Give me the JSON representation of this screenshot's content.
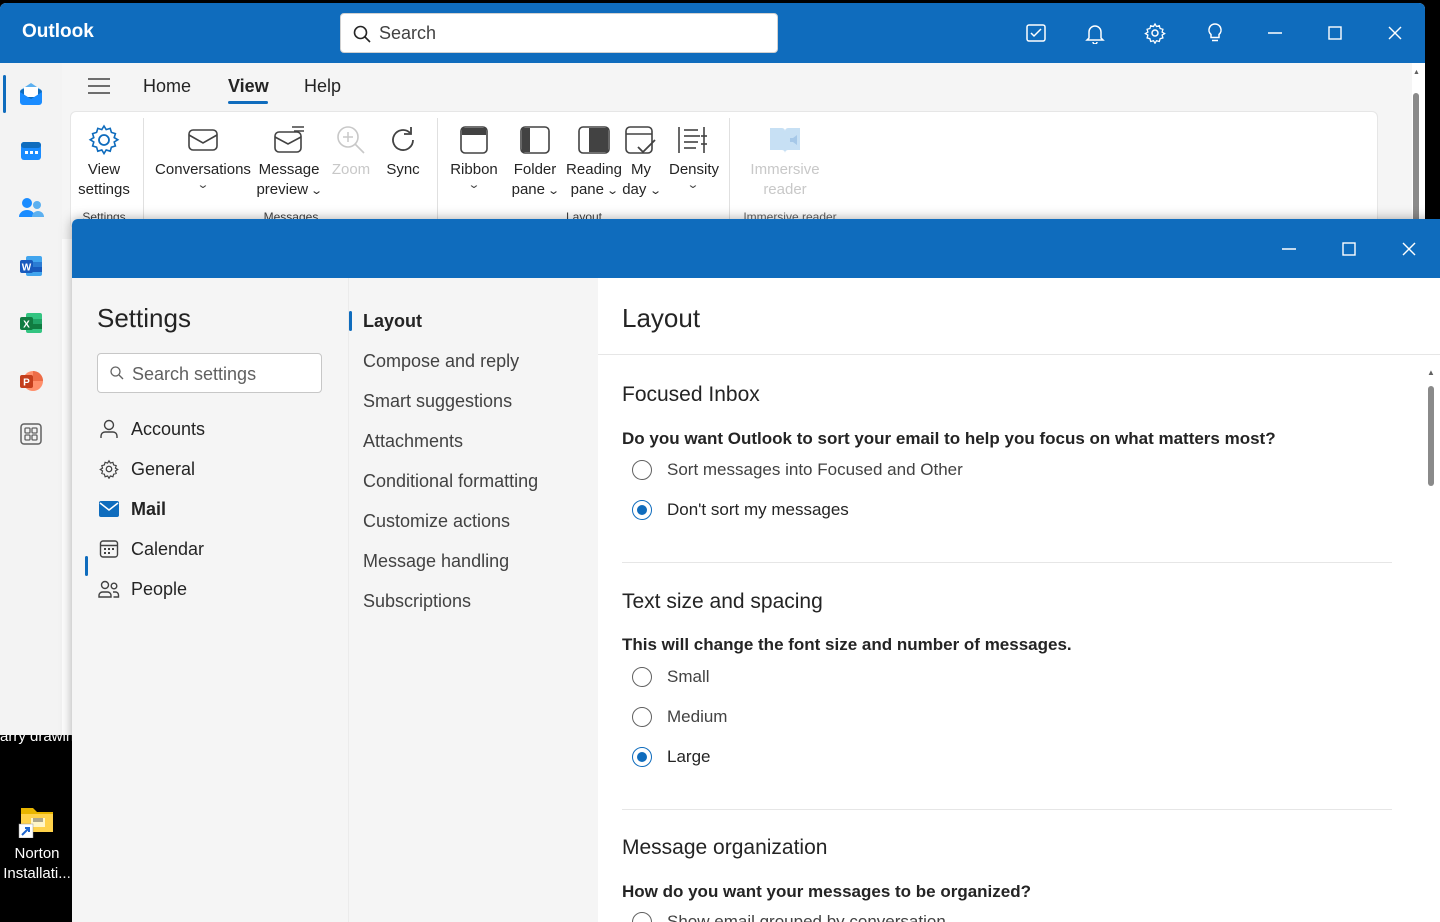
{
  "desktop": {
    "fragment_text": "arry drawin",
    "shortcut_label_line1": "Norton",
    "shortcut_label_line2": "Installati..."
  },
  "outlook": {
    "app_title": "Outlook",
    "search_placeholder": "Search",
    "titlebar_icons": [
      "my-day-icon",
      "bell-icon",
      "gear-icon",
      "lightbulb-icon",
      "minimize-icon",
      "maximize-icon",
      "close-icon"
    ],
    "rail_apps": [
      "mail-icon",
      "calendar-icon",
      "people-icon",
      "word-icon",
      "excel-icon",
      "powerpoint-icon",
      "apps-icon"
    ],
    "ribbon_tabs": [
      "Home",
      "View",
      "Help"
    ],
    "active_tab": "View",
    "ribbon": {
      "settings_group": {
        "label": "Settings",
        "view_settings_line1": "View",
        "view_settings_line2": "settings"
      },
      "messages_group": {
        "label": "Messages",
        "conversations": "Conversations",
        "message_preview_line1": "Message",
        "message_preview_line2": "preview",
        "zoom": "Zoom",
        "sync": "Sync"
      },
      "layout_group": {
        "label": "Layout",
        "ribbon": "Ribbon",
        "folder_pane_line1": "Folder",
        "folder_pane_line2": "pane",
        "reading_pane_line1": "Reading",
        "reading_pane_line2": "pane",
        "my_day_line1": "My",
        "my_day_line2": "day",
        "density": "Density"
      },
      "immersive_group": {
        "label": "Immersive reader",
        "immersive_line1": "Immersive",
        "immersive_line2": "reader"
      }
    }
  },
  "settings": {
    "title": "Settings",
    "search_placeholder": "Search settings",
    "nav": [
      {
        "label": "Accounts",
        "icon": "person-icon"
      },
      {
        "label": "General",
        "icon": "gear-icon"
      },
      {
        "label": "Mail",
        "icon": "mail-icon"
      },
      {
        "label": "Calendar",
        "icon": "calendar-icon"
      },
      {
        "label": "People",
        "icon": "people-icon"
      }
    ],
    "active_nav": "Mail",
    "subnav": [
      "Layout",
      "Compose and reply",
      "Smart suggestions",
      "Attachments",
      "Conditional formatting",
      "Customize actions",
      "Message handling",
      "Subscriptions"
    ],
    "active_subnav": "Layout",
    "content": {
      "title": "Layout",
      "focused_inbox": {
        "title": "Focused Inbox",
        "question": "Do you want Outlook to sort your email to help you focus on what matters most?",
        "options": [
          "Sort messages into Focused and Other",
          "Don't sort my messages"
        ],
        "selected": "Don't sort my messages"
      },
      "text_size": {
        "title": "Text size and spacing",
        "question": "This will change the font size and number of messages.",
        "options": [
          "Small",
          "Medium",
          "Large"
        ],
        "selected": "Large"
      },
      "message_org": {
        "title": "Message organization",
        "question": "How do you want your messages to be organized?",
        "options": [
          "Show email grouped by conversation"
        ]
      }
    }
  },
  "colors": {
    "brand_blue": "#0f6cbd",
    "nav_bg": "#f5f5f5",
    "text": "#242424"
  }
}
